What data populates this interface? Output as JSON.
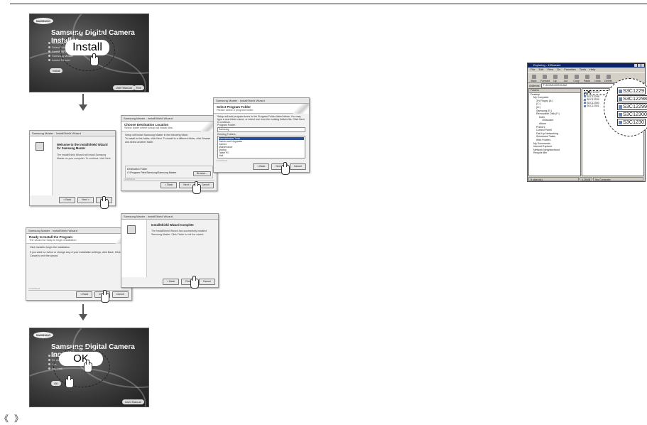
{
  "step1": {
    "brand": "SAMSUNG",
    "title": "Samsung Digital Camera Installer",
    "options": [
      "Go to site",
      "Select folder",
      "Samsung Master",
      "Samsung Master",
      "Adobe Reader"
    ],
    "install_btn": "Install",
    "zoom_label": "Install",
    "bottom_buttons": [
      "User Manual",
      "Exit"
    ]
  },
  "welcome_dlg": {
    "title": "Samsung Master - InstallShield Wizard",
    "heading": "Welcome to the InstallShield Wizard for Samsung Master",
    "text": "The InstallShield Wizard will install Samsung Master on your computer. To continue, click Next.",
    "buttons": [
      "< Back",
      "Next >",
      "Cancel"
    ]
  },
  "dest_dlg": {
    "title": "Samsung Master - InstallShield Wizard",
    "heading": "Choose Destination Location",
    "subheading": "Select folder where setup will install files.",
    "text1": "Setup will install Samsung Master in the following folder.",
    "text2": "To install to this folder, click Next. To install to a different folder, click Browse and select another folder.",
    "folder_label": "Destination Folder",
    "folder_path": "C:\\Program Files\\Samsung\\Samsung Master",
    "browse": "Browse...",
    "footer": "InstallShield",
    "buttons": [
      "< Back",
      "Next >",
      "Cancel"
    ]
  },
  "program_dlg": {
    "title": "Samsung Master - InstallShield Wizard",
    "heading": "Select Program Folder",
    "subheading": "Please select a program folder.",
    "text": "Setup will add program icons to the Program Folder listed below. You may type a new folder name, or select one from the existing folders list. Click Next to continue.",
    "program_folder_label": "Program Folder:",
    "program_folder_value": "Samsung",
    "existing_label": "Existing Folders:",
    "existing": [
      "Administrative Tools",
      "Games and Upgrades",
      "Games",
      "Maintenance",
      "Startup",
      "Tablet PC",
      "Visit"
    ],
    "footer": "InstallShield",
    "buttons": [
      "< Back",
      "Next >",
      "Cancel"
    ]
  },
  "ready_dlg": {
    "title": "Samsung Master - InstallShield Wizard",
    "heading": "Ready to Install the Program",
    "subheading": "The wizard is ready to begin installation.",
    "text1": "Click Install to begin the installation.",
    "text2": "If you want to review or change any of your installation settings, click Back. Click Cancel to exit the wizard.",
    "footer": "InstallShield",
    "buttons": [
      "< Back",
      "Install",
      "Cancel"
    ]
  },
  "complete_dlg": {
    "title": "Samsung Master - InstallShield Wizard",
    "heading": "InstallShield Wizard Complete",
    "text": "The InstallShield Wizard has successfully installed Samsung Master. Click Finish to exit the wizard.",
    "buttons": [
      "< Back",
      "Finish",
      "Cancel"
    ]
  },
  "step_final": {
    "brand": "SAMSUNG",
    "title": "Samsung Digital Camera Installer",
    "options": [
      "Setup finished",
      "Restart computer",
      "Yes",
      "No, I will"
    ],
    "ok_btn": "OK",
    "zoom_label": "OK",
    "bottom_buttons": [
      "User Manual"
    ]
  },
  "explorer": {
    "title": "Exploring - 100sscam",
    "menu": [
      "File",
      "Edit",
      "View",
      "Go",
      "Favorites",
      "Tools",
      "Help"
    ],
    "toolbar": [
      "Back",
      "Forward",
      "Up",
      "Cut",
      "Copy",
      "Paste",
      "Undo",
      "Delete"
    ],
    "address_label": "Address",
    "address": "F:\\DCIM\\100SSCAM",
    "folders_label": "Folders",
    "tree": [
      "Desktop",
      "My Computer",
      "3½ Floppy (A:)",
      "(C:)",
      "(D:)",
      "Samsung (E:)",
      "Removable Disk (F:)",
      "Dcim",
      "100sscam",
      "Album",
      "Printers",
      "Control Panel",
      "Dial-Up Networking",
      "Scheduled Tasks",
      "Web Folders",
      "My Documents",
      "Internet Explorer",
      "Network Neighborhood",
      "Recycle Bin"
    ],
    "files": [
      "SDC12297",
      "SDC12298",
      "SDC12299",
      "SDC12300",
      "SDC12301"
    ],
    "zoom_files": [
      "S3C1229",
      "S3C12298",
      "S3C12299",
      "S3C12300",
      "S3C1230"
    ],
    "status": [
      "5 object(s)",
      "4.29MB",
      "My Computer"
    ]
  },
  "pager": [
    "《",
    "》"
  ]
}
